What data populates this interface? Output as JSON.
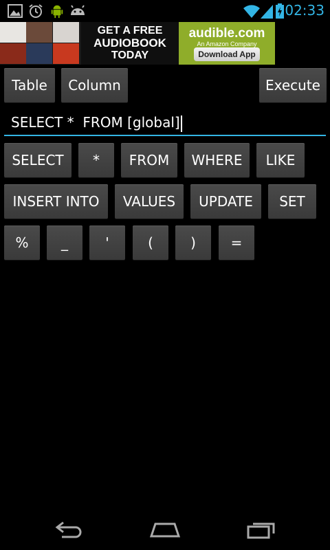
{
  "status_bar": {
    "time": "02:33",
    "left_icons": [
      "image-icon",
      "alarm-clock-icon",
      "android-icon",
      "android-face-icon"
    ],
    "right_icons": [
      "wifi-icon",
      "signal-icon",
      "battery-charging-icon"
    ],
    "accent": "#33b5e5"
  },
  "ad": {
    "headline_line1": "GET A FREE",
    "headline_line2": "AUDIOBOOK",
    "headline_line3": "TODAY",
    "brand": "audible.com",
    "brand_sub": "An Amazon Company",
    "cta": "Download App"
  },
  "toolbar": {
    "table_label": "Table",
    "column_label": "Column",
    "execute_label": "Execute"
  },
  "query": {
    "value": "SELECT *  FROM [global]"
  },
  "keywords": {
    "row1": [
      "SELECT",
      "*",
      "FROM",
      "WHERE",
      "LIKE"
    ],
    "row2": [
      "INSERT INTO",
      "VALUES",
      "UPDATE",
      "SET"
    ],
    "row3": [
      "%",
      "_",
      "'",
      "(",
      ")",
      "="
    ]
  },
  "nav": {
    "icons": [
      "back-icon",
      "home-icon",
      "recent-apps-icon"
    ]
  }
}
